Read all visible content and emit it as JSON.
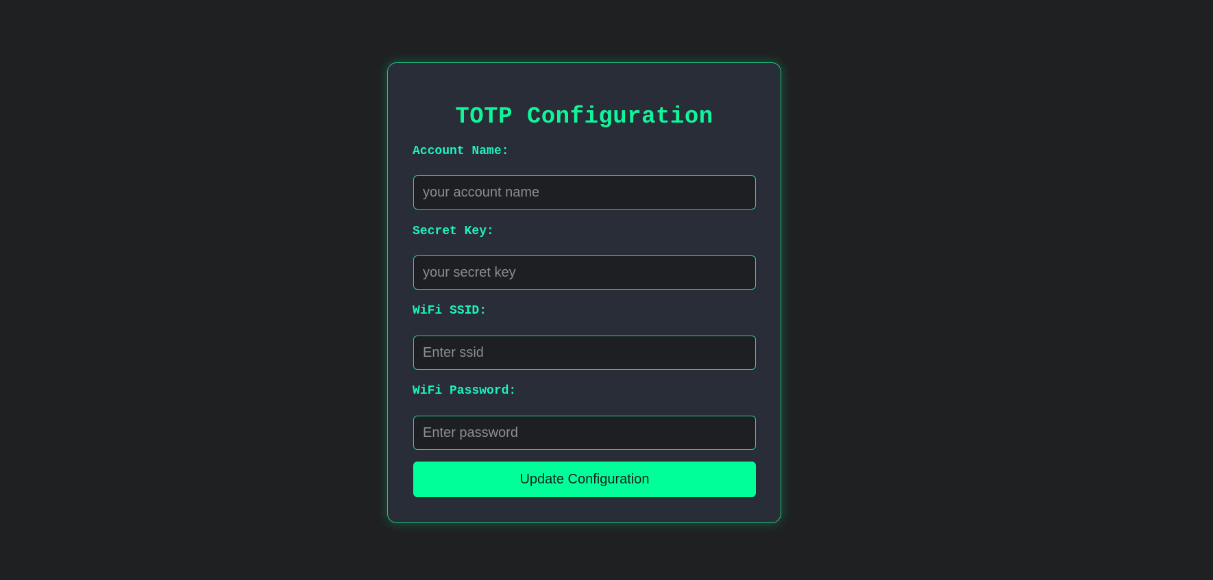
{
  "form": {
    "title": "TOTP Configuration",
    "fields": [
      {
        "label": "Account Name:",
        "value": "",
        "placeholder": "your account name"
      },
      {
        "label": "Secret Key:",
        "value": "",
        "placeholder": "your secret key"
      },
      {
        "label": "WiFi SSID:",
        "value": "",
        "placeholder": "Enter ssid"
      },
      {
        "label": "WiFi Password:",
        "value": "",
        "placeholder": "Enter password"
      }
    ],
    "submit_label": "Update Configuration"
  },
  "colors": {
    "page_background": "#1f2022",
    "card_background": "#282d37",
    "accent": "#00ff99",
    "title": "#11f59a",
    "label": "#1ef2c0",
    "input_border": "#1fd39e",
    "input_background": "#1e1f23",
    "placeholder": "#8a8d92"
  }
}
